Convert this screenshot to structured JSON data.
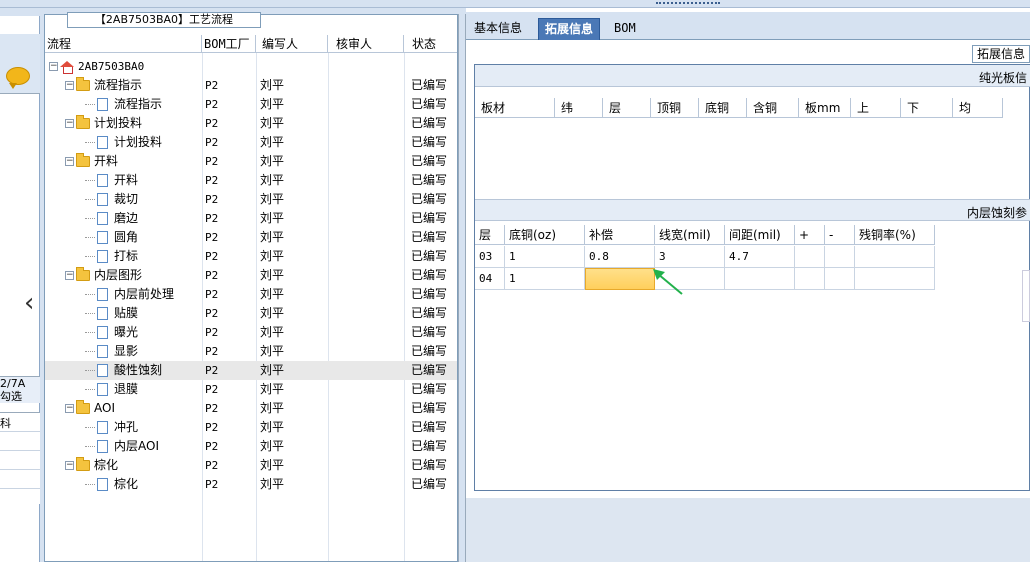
{
  "left_strip": {
    "text_line1": "2/7A",
    "text_line2": "勾选",
    "grid_label": "科"
  },
  "flow_panel": {
    "title": "【2AB7503BA0】工艺流程",
    "columns": [
      "流程",
      "BOM工厂",
      "编写人",
      "核审人",
      "状态"
    ],
    "rows": [
      {
        "name": "2AB7503BA0",
        "level": 0,
        "icon": "home-icon",
        "bom": "",
        "author": "",
        "reviewer": "",
        "status": ""
      },
      {
        "name": "流程指示",
        "level": 1,
        "icon": "folder-icon",
        "bom": "P2",
        "author": "刘平",
        "reviewer": "",
        "status": "已编写"
      },
      {
        "name": "流程指示",
        "level": 2,
        "icon": "document-icon",
        "bom": "P2",
        "author": "刘平",
        "reviewer": "",
        "status": "已编写"
      },
      {
        "name": "计划投料",
        "level": 1,
        "icon": "folder-icon",
        "bom": "P2",
        "author": "刘平",
        "reviewer": "",
        "status": "已编写"
      },
      {
        "name": "计划投料",
        "level": 2,
        "icon": "document-icon",
        "bom": "P2",
        "author": "刘平",
        "reviewer": "",
        "status": "已编写"
      },
      {
        "name": "开料",
        "level": 1,
        "icon": "folder-icon",
        "bom": "P2",
        "author": "刘平",
        "reviewer": "",
        "status": "已编写"
      },
      {
        "name": "开料",
        "level": 2,
        "icon": "document-icon",
        "bom": "P2",
        "author": "刘平",
        "reviewer": "",
        "status": "已编写"
      },
      {
        "name": "裁切",
        "level": 2,
        "icon": "document-icon",
        "bom": "P2",
        "author": "刘平",
        "reviewer": "",
        "status": "已编写"
      },
      {
        "name": "磨边",
        "level": 2,
        "icon": "document-icon",
        "bom": "P2",
        "author": "刘平",
        "reviewer": "",
        "status": "已编写"
      },
      {
        "name": "圆角",
        "level": 2,
        "icon": "document-icon",
        "bom": "P2",
        "author": "刘平",
        "reviewer": "",
        "status": "已编写"
      },
      {
        "name": "打标",
        "level": 2,
        "icon": "document-icon",
        "bom": "P2",
        "author": "刘平",
        "reviewer": "",
        "status": "已编写"
      },
      {
        "name": "内层图形",
        "level": 1,
        "icon": "folder-icon",
        "bom": "P2",
        "author": "刘平",
        "reviewer": "",
        "status": "已编写"
      },
      {
        "name": "内层前处理",
        "level": 2,
        "icon": "document-icon",
        "bom": "P2",
        "author": "刘平",
        "reviewer": "",
        "status": "已编写"
      },
      {
        "name": "贴膜",
        "level": 2,
        "icon": "document-icon",
        "bom": "P2",
        "author": "刘平",
        "reviewer": "",
        "status": "已编写"
      },
      {
        "name": "曝光",
        "level": 2,
        "icon": "document-icon",
        "bom": "P2",
        "author": "刘平",
        "reviewer": "",
        "status": "已编写"
      },
      {
        "name": "显影",
        "level": 2,
        "icon": "document-icon",
        "bom": "P2",
        "author": "刘平",
        "reviewer": "",
        "status": "已编写"
      },
      {
        "name": "酸性蚀刻",
        "level": 2,
        "icon": "document-icon",
        "bom": "P2",
        "author": "刘平",
        "reviewer": "",
        "status": "已编写",
        "selected": true
      },
      {
        "name": "退膜",
        "level": 2,
        "icon": "document-icon",
        "bom": "P2",
        "author": "刘平",
        "reviewer": "",
        "status": "已编写"
      },
      {
        "name": "AOI",
        "level": 1,
        "icon": "folder-icon",
        "bom": "P2",
        "author": "刘平",
        "reviewer": "",
        "status": "已编写"
      },
      {
        "name": "冲孔",
        "level": 2,
        "icon": "document-icon",
        "bom": "P2",
        "author": "刘平",
        "reviewer": "",
        "status": "已编写"
      },
      {
        "name": "内层AOI",
        "level": 2,
        "icon": "document-icon",
        "bom": "P2",
        "author": "刘平",
        "reviewer": "",
        "status": "已编写"
      },
      {
        "name": "棕化",
        "level": 1,
        "icon": "folder-icon",
        "bom": "P2",
        "author": "刘平",
        "reviewer": "",
        "status": "已编写"
      },
      {
        "name": "棕化",
        "level": 2,
        "icon": "document-icon",
        "bom": "P2",
        "author": "刘平",
        "reviewer": "",
        "status": "已编写"
      }
    ]
  },
  "tabs": {
    "items": [
      "基本信息",
      "拓展信息",
      "BOM"
    ],
    "active": "拓展信息",
    "sub_tab": "拓展信息"
  },
  "board_section": {
    "title": "纯光板信",
    "columns": [
      "板材",
      "纬",
      "层",
      "顶铜",
      "底铜",
      "含铜",
      "板mm",
      "上",
      "下",
      "均"
    ]
  },
  "etch_section": {
    "title": "内层蚀刻参",
    "columns": [
      "层",
      "底铜(oz)",
      "补偿",
      "线宽(mil)",
      "间距(mil)",
      "+",
      "-",
      "残铜率(%)"
    ],
    "rows": [
      {
        "layer": "03",
        "base_copper": "1",
        "compensation": "0.8",
        "line_width": "3",
        "spacing": "4.7",
        "plus": "",
        "minus": "",
        "residual": ""
      },
      {
        "layer": "04",
        "base_copper": "1",
        "compensation": "",
        "line_width": "",
        "spacing": "",
        "plus": "",
        "minus": "",
        "residual": ""
      }
    ]
  },
  "colors": {
    "accent_tab": "#4a78b6",
    "highlight_cell": "#ffcf5c",
    "cursor_arrow": "#22b14c"
  }
}
